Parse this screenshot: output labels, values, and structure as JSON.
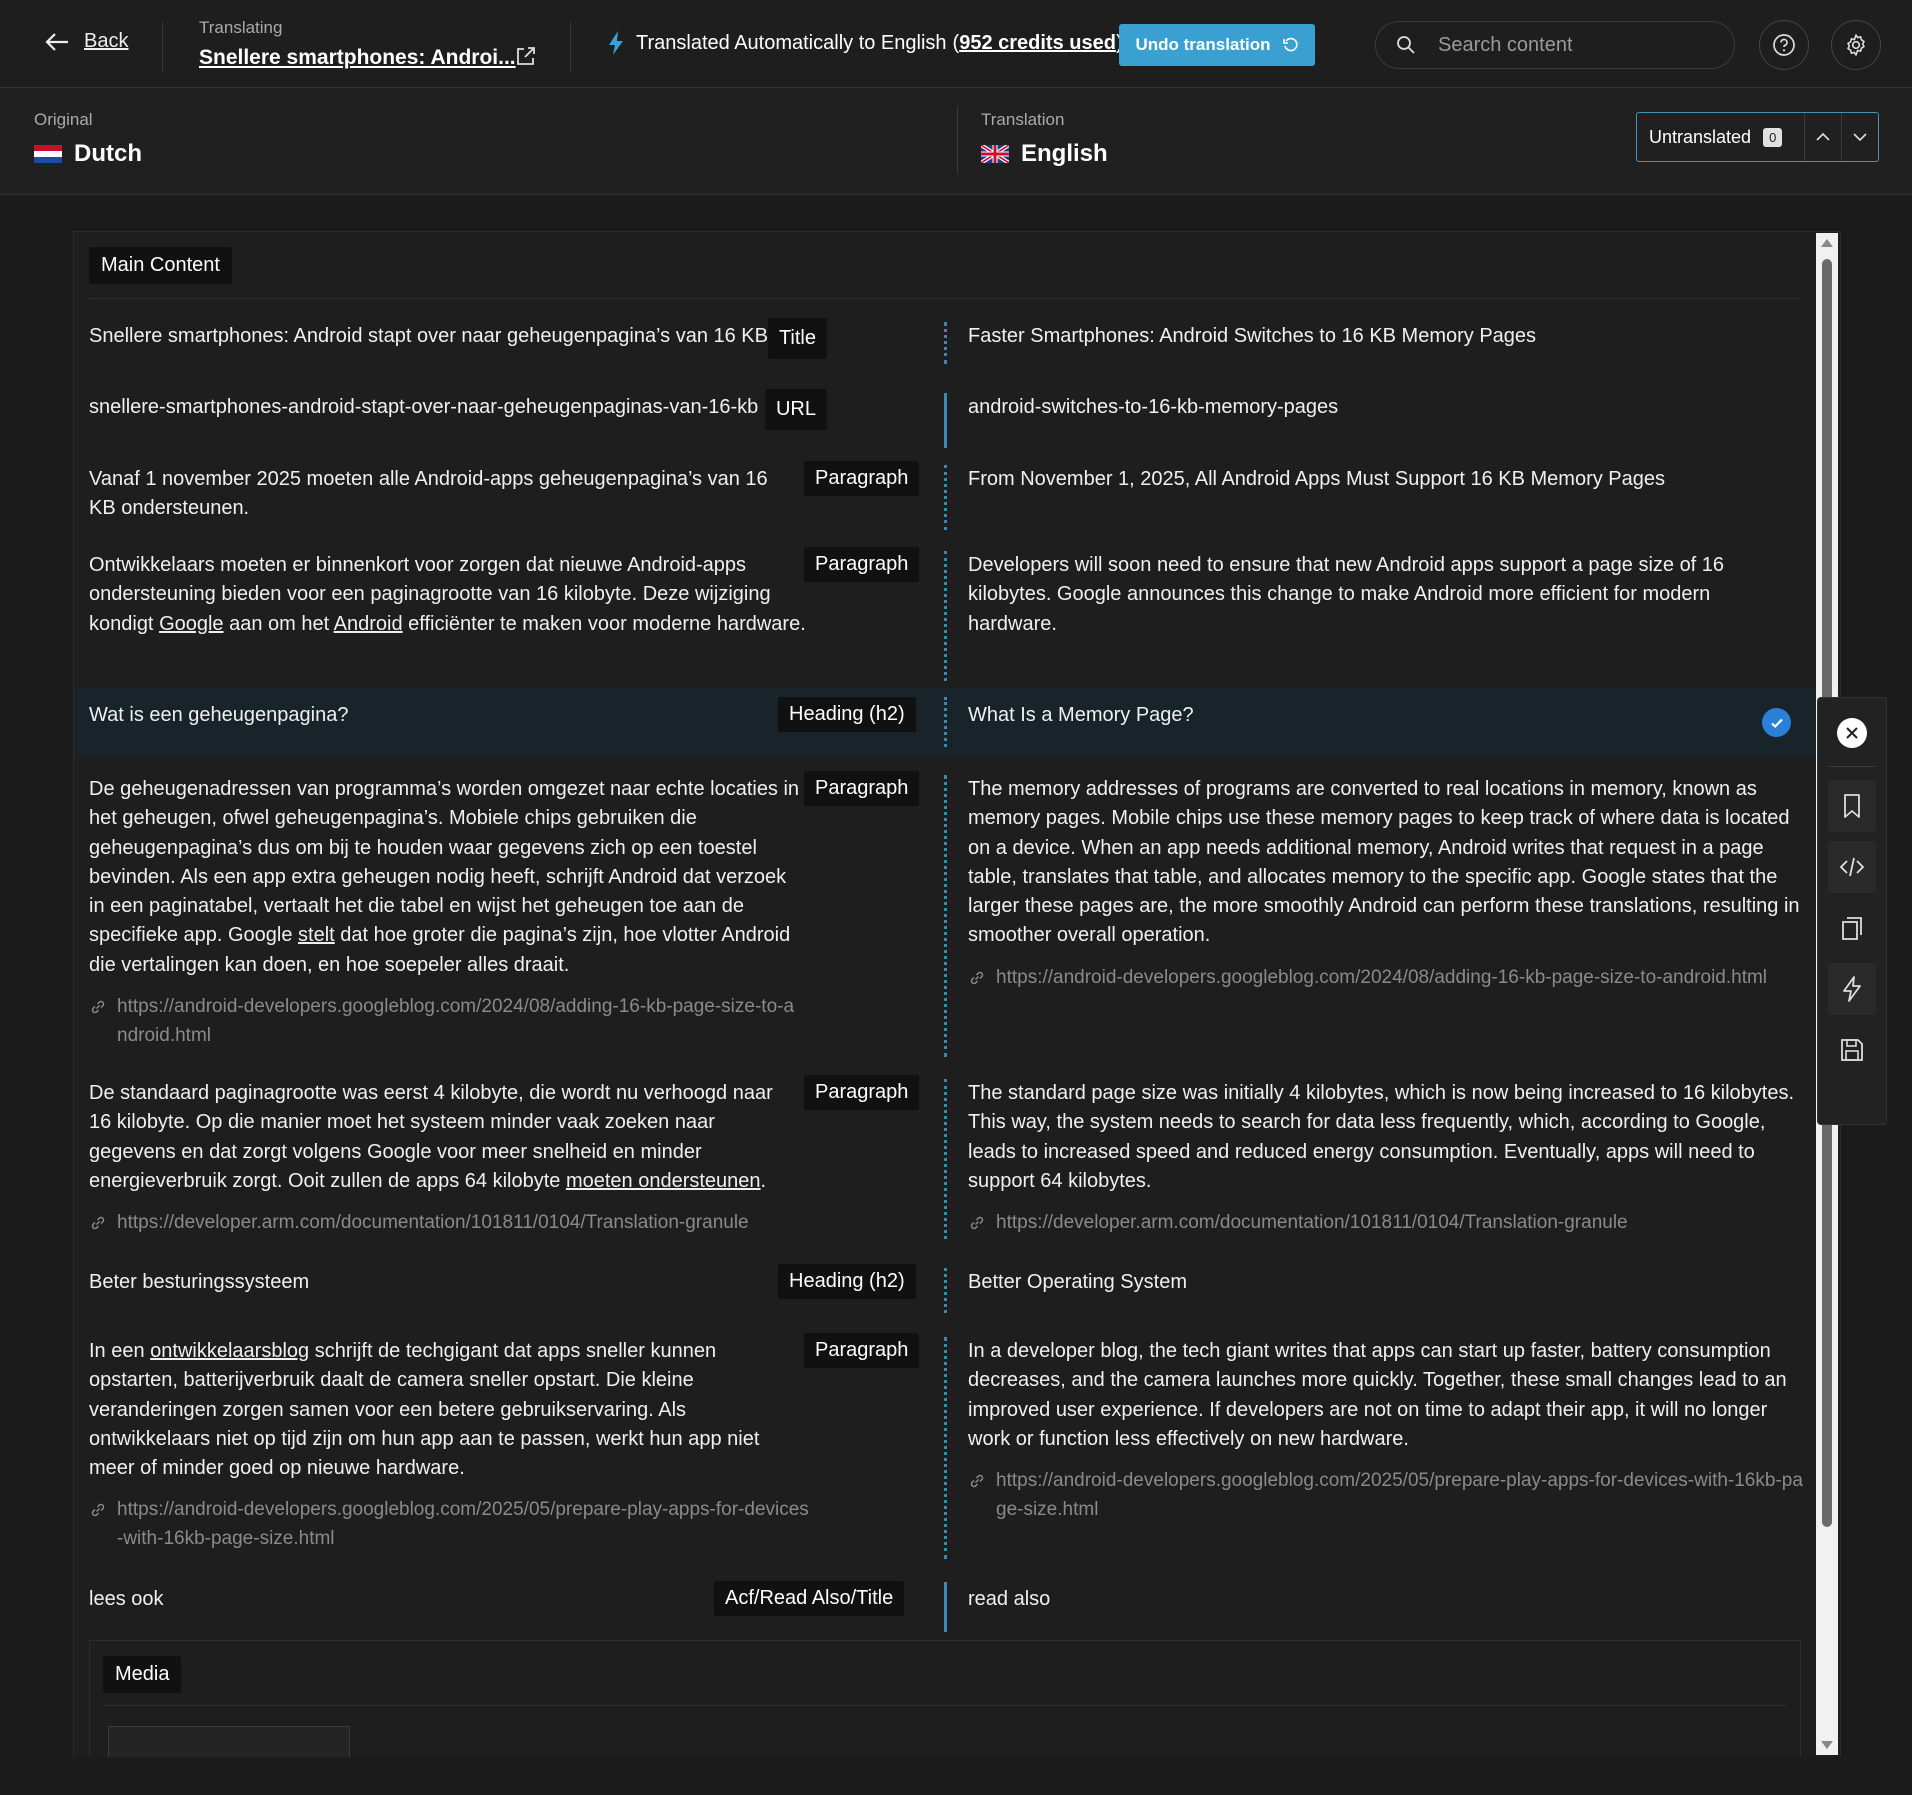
{
  "header": {
    "back_label": "Back",
    "translating_label": "Translating",
    "post_title": "Snellere smartphones: Androi...",
    "auto_text": "Translated Automatically to English",
    "credits_text": "952 credits used",
    "undo_label": "Undo translation",
    "search_placeholder": "Search content"
  },
  "languages": {
    "original_label": "Original",
    "original_name": "Dutch",
    "translation_label": "Translation",
    "translation_name": "English",
    "filter_label": "Untranslated",
    "filter_count": "0"
  },
  "sections": {
    "main": "Main Content",
    "media": "Media"
  },
  "rows": [
    {
      "original": "Snellere smartphones: Android stapt over naar geheugenpagina’s van 16 KB",
      "tag": "Title",
      "translation": "Faster Smartphones: Android Switches to 16 KB Memory Pages"
    },
    {
      "original": "snellere-smartphones-android-stapt-over-naar-geheugenpaginas-van-16-kb",
      "tag": "URL",
      "translation": "android-switches-to-16-kb-memory-pages"
    },
    {
      "original": "Vanaf 1 november 2025 moeten alle Android-apps geheugenpagina’s van 16 KB ondersteunen.",
      "tag": "Paragraph",
      "translation": "From November 1, 2025, All Android Apps Must Support 16 KB Memory Pages"
    },
    {
      "original_parts": [
        "Ontwikkelaars moeten er binnenkort voor zorgen dat nieuwe Android-apps ondersteuning bieden voor een paginagrootte van 16 kilobyte. Deze wijziging kondigt ",
        "Google",
        " aan om het ",
        "Android",
        " efficiënter te maken voor moderne hardware."
      ],
      "tag": "Paragraph",
      "translation": "Developers will soon need to ensure that new Android apps support a page size of 16 kilobytes. Google announces this change to make Android more efficient for modern hardware."
    },
    {
      "original": "Wat is een geheugenpagina?",
      "tag": "Heading (h2)",
      "translation": "What Is a Memory Page?"
    },
    {
      "original_parts": [
        "De geheugenadressen van programma’s worden omgezet naar echte locaties in het geheugen, ofwel geheugenpagina’s. Mobiele chips gebruiken die geheugenpagina’s dus om bij te houden waar gegevens zich op een toestel bevinden. Als een app extra geheugen nodig heeft, schrijft Android dat verzoek in een paginatabel, vertaalt het die tabel en wijst het geheugen toe aan de specifieke app. Google ",
        "stelt",
        " dat hoe groter die pagina’s zijn, hoe vlotter Android die vertalingen kan doen, en hoe soepeler alles draait."
      ],
      "tag": "Paragraph",
      "translation": "The memory addresses of programs are converted to real locations in memory, known as memory pages. Mobile chips use these memory pages to keep track of where data is located on a device. When an app needs additional memory, Android writes that request in a page table, translates that table, and allocates memory to the specific app. Google states that the larger these pages are, the more smoothly Android can perform these translations, resulting in smoother overall operation.",
      "link": "https://android-developers.googleblog.com/2024/08/adding-16-kb-page-size-to-android.html"
    },
    {
      "original_parts": [
        "De standaard paginagrootte was eerst 4 kilobyte, die wordt nu verhoogd naar 16 kilobyte. Op die manier moet het systeem minder vaak zoeken naar gegevens en dat zorgt volgens Google voor meer snelheid en minder energieverbruik zorgt. Ooit zullen de apps 64 kilobyte ",
        "moeten ondersteunen",
        "."
      ],
      "tag": "Paragraph",
      "translation": "The standard page size was initially 4 kilobytes, which is now being increased to 16 kilobytes. This way, the system needs to search for data less frequently, which, according to Google, leads to increased speed and reduced energy consumption. Eventually, apps will need to support 64 kilobytes.",
      "link": "https://developer.arm.com/documentation/101811/0104/Translation-granule"
    },
    {
      "original": "Beter besturingssysteem",
      "tag": "Heading (h2)",
      "translation": "Better Operating System"
    },
    {
      "original_parts": [
        "In een ",
        "ontwikkelaarsblog",
        " schrijft de techgigant dat apps sneller kunnen opstarten, batterijverbruik daalt de camera sneller opstart. Die kleine veranderingen zorgen samen voor een betere gebruikservaring. Als ontwikkelaars niet op tijd zijn om hun app aan te passen, werkt hun app niet meer of minder goed op nieuwe hardware."
      ],
      "tag": "Paragraph",
      "translation": "In a developer blog, the tech giant writes that apps can start up faster, battery consumption decreases, and the camera launches more quickly. Together, these small changes lead to an improved user experience. If developers are not on time to adapt their app, it will no longer work or function less effectively on new hardware.",
      "link": "https://android-developers.googleblog.com/2025/05/prepare-play-apps-for-devices-with-16kb-page-size.html"
    },
    {
      "original": "lees ook",
      "tag": "Acf/Read Also/Title",
      "translation": "read also"
    }
  ],
  "toolbar": {
    "icons": [
      "close-icon",
      "bookmark-icon",
      "code-icon",
      "copy-icon",
      "bolt-icon",
      "save-icon"
    ]
  },
  "colors": {
    "accent": "#3aa0d1",
    "divider": "#3d87b5",
    "check": "#2a7fd6",
    "background": "#1b1b1b"
  }
}
